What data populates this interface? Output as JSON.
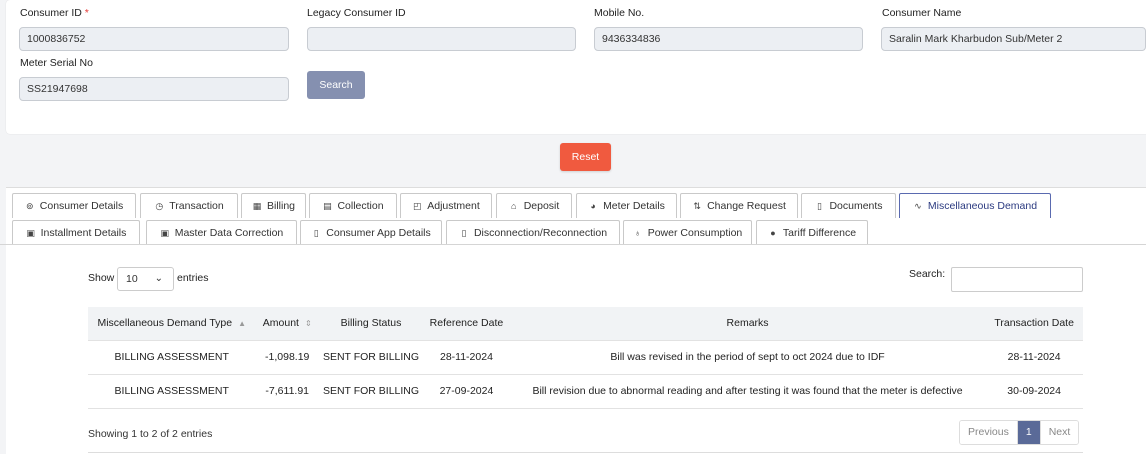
{
  "form": {
    "consumer_id_label": "Consumer ID",
    "required_mark": "*",
    "consumer_id_value": "1000836752",
    "legacy_id_label": "Legacy Consumer ID",
    "legacy_id_value": "",
    "mobile_label": "Mobile No.",
    "mobile_value": "9436334836",
    "consumer_name_label": "Consumer Name",
    "consumer_name_value": "Saralin Mark Kharbudon Sub/Meter 2",
    "meter_serial_label": "Meter Serial No",
    "meter_serial_value": "SS21947698",
    "search_button": "Search",
    "reset_button": "Reset"
  },
  "tabs": [
    {
      "label": "Consumer Details",
      "icon": "⊚"
    },
    {
      "label": "Transaction",
      "icon": "◷"
    },
    {
      "label": "Billing",
      "icon": "▦"
    },
    {
      "label": "Collection",
      "icon": "▤"
    },
    {
      "label": "Adjustment",
      "icon": "◰"
    },
    {
      "label": "Deposit",
      "icon": "⌂"
    },
    {
      "label": "Meter Details",
      "icon": "◕"
    },
    {
      "label": "Change Request",
      "icon": "⇅"
    },
    {
      "label": "Documents",
      "icon": "▯"
    },
    {
      "label": "Miscellaneous Demand",
      "icon": "∿"
    },
    {
      "label": "Installment Details",
      "icon": "▣"
    },
    {
      "label": "Master Data Correction",
      "icon": "▣"
    },
    {
      "label": "Consumer App Details",
      "icon": "▯"
    },
    {
      "label": "Disconnection/Reconnection",
      "icon": "▯"
    },
    {
      "label": "Power Consumption",
      "icon": "♁"
    },
    {
      "label": "Tariff Difference",
      "icon": "●"
    }
  ],
  "active_tab": "Miscellaneous Demand",
  "table_controls": {
    "show_label": "Show",
    "entries_value": "10",
    "entries_label": "entries",
    "search_label": "Search:"
  },
  "table": {
    "headers": [
      "Miscellaneous Demand Type",
      "Amount",
      "Billing Status",
      "Reference Date",
      "Remarks",
      "Transaction Date"
    ],
    "rows": [
      [
        "BILLING ASSESSMENT",
        "-1,098.19",
        "SENT FOR BILLING",
        "28-11-2024",
        "Bill was revised in the period of sept to oct 2024 due to IDF",
        "28-11-2024"
      ],
      [
        "BILLING ASSESSMENT",
        "-7,611.91",
        "SENT FOR BILLING",
        "27-09-2024",
        "Bill revision due to abnormal reading and after testing it was found that the meter is defective",
        "30-09-2024"
      ]
    ]
  },
  "footer": {
    "showing_text": "Showing 1 to 2 of 2 entries",
    "previous": "Previous",
    "current_page": "1",
    "next": "Next"
  },
  "colors": {
    "search_button": "#8590b0",
    "reset_button": "#f05a3f",
    "active_page": "#5a6a98"
  }
}
